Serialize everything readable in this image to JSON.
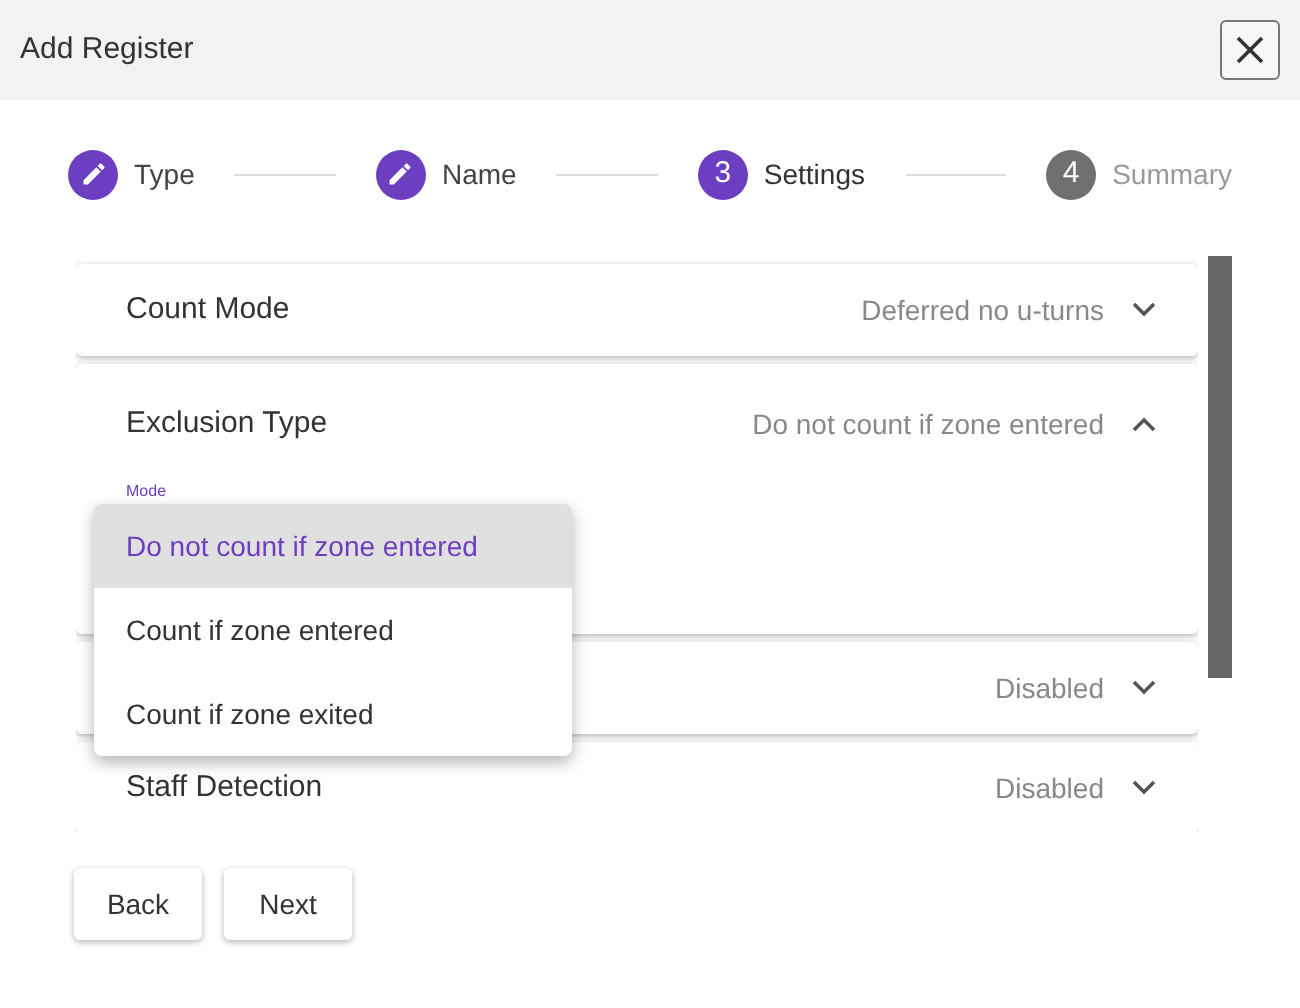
{
  "window": {
    "title": "Add Register"
  },
  "steps": [
    {
      "kind": "done",
      "label": "Type"
    },
    {
      "kind": "done",
      "label": "Name"
    },
    {
      "kind": "active",
      "number": "3",
      "label": "Settings"
    },
    {
      "kind": "pending",
      "number": "4",
      "label": "Summary"
    }
  ],
  "panels": [
    {
      "title": "Count Mode",
      "value": "Deferred no u-turns",
      "expanded": false
    },
    {
      "title": "Exclusion Type",
      "value": "Do not count if zone entered",
      "expanded": true,
      "field": {
        "label": "Mode"
      }
    },
    {
      "value": "Disabled",
      "expanded": false
    },
    {
      "title": "Staff Detection",
      "value": "Disabled",
      "expanded": false
    }
  ],
  "menu": [
    {
      "label": "Do not count if zone entered",
      "selected": true
    },
    {
      "label": "Count if zone entered",
      "selected": false
    },
    {
      "label": "Count if zone exited",
      "selected": false
    }
  ],
  "buttons": [
    "Back",
    "Next"
  ]
}
